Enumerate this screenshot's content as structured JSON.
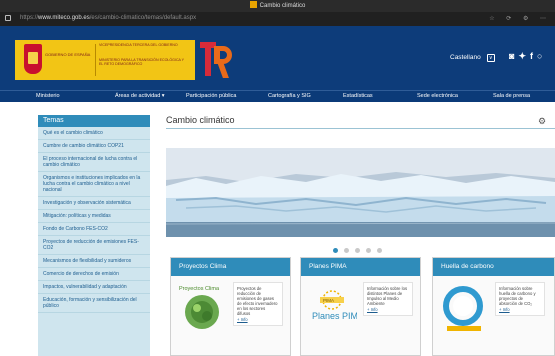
{
  "window": {
    "title": "Cambio climático"
  },
  "address": {
    "prefix": "https://",
    "host": "www.miteco.gob.es",
    "path": "/es/cambio-climatico/temas/default.aspx"
  },
  "gov": {
    "name": "GOBIERNO DE ESPAÑA",
    "vice": "VICEPRESIDENCIA TERCERA DEL GOBIERNO",
    "ministry": "MINISTERIO PARA LA TRANSICIÓN ECOLÓGICA Y EL RETO DEMOGRÁFICO"
  },
  "language": {
    "selected": "Castellano"
  },
  "nav": [
    {
      "label": "Ministerio"
    },
    {
      "label": "Áreas de actividad ▾"
    },
    {
      "label": "Participación pública"
    },
    {
      "label": "Cartografía y SIG"
    },
    {
      "label": "Estadísticas"
    },
    {
      "label": "Sede electrónica"
    },
    {
      "label": "Sala de prensa"
    }
  ],
  "sidebar": {
    "heading": "Temas",
    "items": [
      "Qué es el cambio climático",
      "Cumbre de cambio climático COP21",
      "El proceso internacional de lucha contra el cambio climático",
      "Organismos e instituciones implicados en la lucha contra el cambio climático a nivel nacional",
      "Investigación y observación sistemática",
      "Mitigación: políticas y medidas",
      "Fondo de Carbono FES-CO2",
      "Proyectos de reducción de emisiones FES-CO2",
      "Mecanismos de flexibilidad y sumideros",
      "Comercio de derechos de emisión",
      "Impactos, vulnerabilidad y adaptación",
      "Educación, formación y sensibilización del público"
    ]
  },
  "main": {
    "title": "Cambio climático",
    "cards": [
      {
        "title": "Proyectos Clima",
        "logo": "Proyectos Clima",
        "text": "Proyectos de reducción de emisiones de gases de efecto invernadero en los sectores difusos",
        "more": "+ Info"
      },
      {
        "title": "Planes PIMA",
        "logo": "Planes PIMA",
        "text": "Información sobre los distintos Planes de Impulso al Medio Ambiente",
        "more": "+ Info"
      },
      {
        "title": "Huella de carbono",
        "text": "Información sobre huella de carbono y proyectos de absorción de CO₂",
        "more": "+ Info"
      }
    ]
  }
}
